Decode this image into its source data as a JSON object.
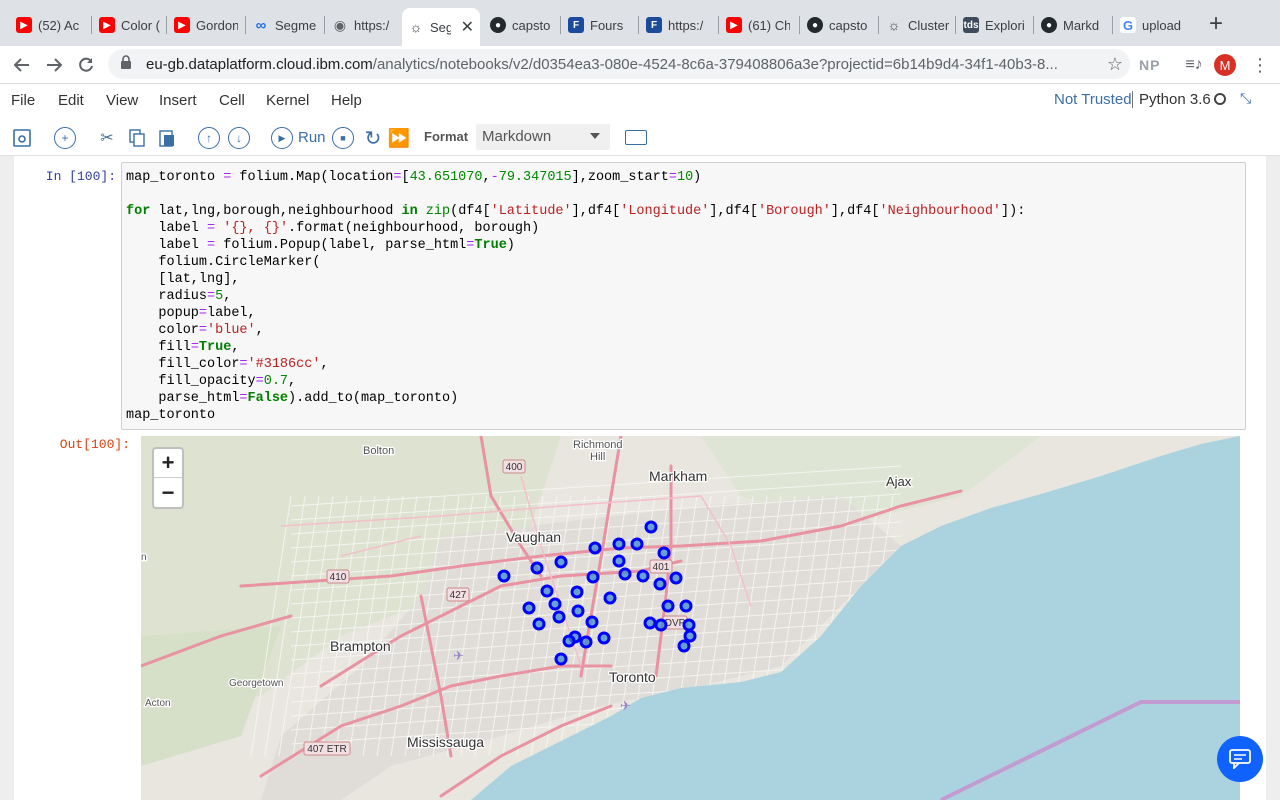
{
  "browser": {
    "tabs": [
      {
        "title": "(52) Ac",
        "icon": "youtube-icon"
      },
      {
        "title": "Color (",
        "icon": "youtube-icon"
      },
      {
        "title": "Gordon",
        "icon": "youtube-icon"
      },
      {
        "title": "Segme",
        "icon": "link-icon"
      },
      {
        "title": "https:/",
        "icon": "globe-icon"
      },
      {
        "title": "Seg",
        "icon": "ibm-bulb-icon",
        "active": true
      },
      {
        "title": "capsto",
        "icon": "github-icon"
      },
      {
        "title": "Fours",
        "icon": "foursquare-icon"
      },
      {
        "title": "https:/",
        "icon": "foursquare-icon"
      },
      {
        "title": "(61) Ch",
        "icon": "youtube-icon"
      },
      {
        "title": "capsto",
        "icon": "github-icon"
      },
      {
        "title": "Cluster",
        "icon": "ibm-bulb-icon"
      },
      {
        "title": "Explori",
        "icon": "tds-icon"
      },
      {
        "title": "Markd",
        "icon": "github-icon"
      },
      {
        "title": "upload",
        "icon": "google-icon"
      }
    ],
    "url_host": "eu-gb.dataplatform.cloud.ibm.com",
    "url_path": "/analytics/notebooks/v2/d0354ea3-080e-4524-8c6a-379408806a3e?projectid=6b14b9d4-34f1-40b3-8...",
    "extension_label": "NP",
    "avatar_letter": "M"
  },
  "jupyter": {
    "menu": [
      "File",
      "Edit",
      "View",
      "Insert",
      "Cell",
      "Kernel",
      "Help"
    ],
    "trust_status": "Not Trusted",
    "kernel": "Python 3.6",
    "toolbar": {
      "run_label": "Run",
      "format_label": "Format",
      "cell_type": "Markdown"
    },
    "cell": {
      "in_prompt": "In [100]:",
      "out_prompt": "Out[100]:"
    }
  },
  "map": {
    "labels": [
      {
        "text": "Richmond"
      },
      {
        "text": "Hill"
      },
      {
        "text": "Bolton"
      },
      {
        "text": "Markham"
      },
      {
        "text": "Ajax"
      },
      {
        "text": "Vaughan"
      },
      {
        "text": "Brampton"
      },
      {
        "text": "Toronto"
      },
      {
        "text": "Georgetown"
      },
      {
        "text": "Acton"
      },
      {
        "text": "Mississauga"
      },
      {
        "text": "n"
      }
    ],
    "shields": [
      "400",
      "401",
      "410",
      "427",
      "407 ETR",
      "DVP"
    ],
    "marker_color": "blue",
    "marker_fill": "#3186cc",
    "water_color": "#aad3df",
    "zoom_in": "+",
    "zoom_out": "−"
  }
}
